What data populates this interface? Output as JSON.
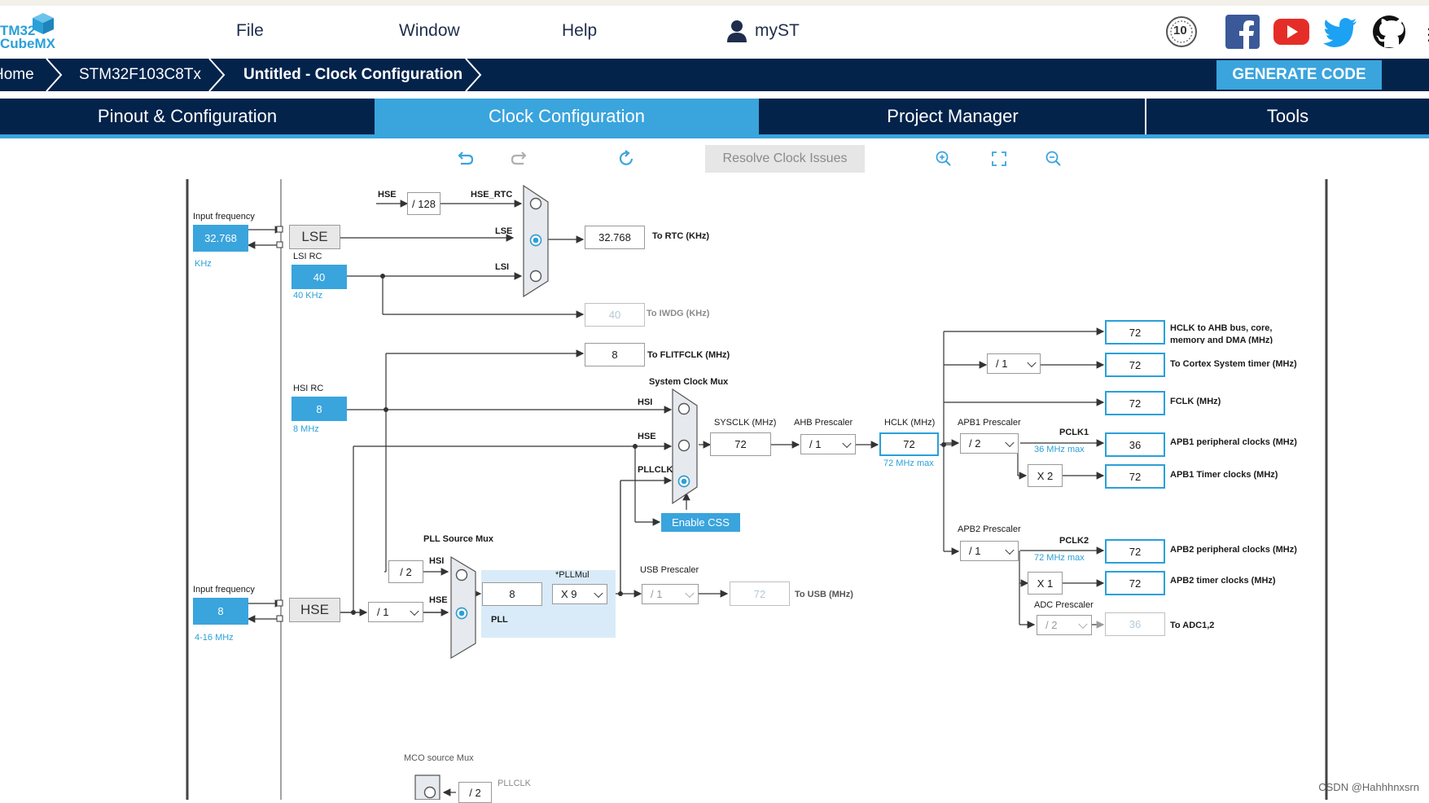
{
  "app": {
    "logo_line1": "TM32",
    "logo_line2": "CubeMX"
  },
  "menu": {
    "file": "File",
    "window": "Window",
    "help": "Help",
    "myst": "myST"
  },
  "badge": "10",
  "breadcrumb": {
    "home": "Home",
    "device": "STM32F103C8Tx",
    "page": "Untitled - Clock Configuration"
  },
  "generate_code": "GENERATE CODE",
  "tabs": {
    "pinout": "Pinout & Configuration",
    "clock": "Clock Configuration",
    "project": "Project Manager",
    "tools": "Tools"
  },
  "toolbar": {
    "resolve": "Resolve Clock Issues"
  },
  "diagram": {
    "lse_input_label": "Input frequency",
    "lse_input_value": "32.768",
    "lse_input_unit": "KHz",
    "lse_label": "LSE",
    "lsi_rc_label": "LSI RC",
    "lsi_value": "40",
    "lsi_unit": "40 KHz",
    "hse_rtc_src": "HSE",
    "hse_rtc_div": "/ 128",
    "hse_rtc_label": "HSE_RTC",
    "rtc_lse_label": "LSE",
    "rtc_lsi_label": "LSI",
    "rtc_value": "32.768",
    "rtc_out": "To RTC (KHz)",
    "iwdg_value": "40",
    "iwdg_out": "To IWDG (KHz)",
    "flit_value": "8",
    "flit_out": "To FLITFCLK (MHz)",
    "hsi_rc_label": "HSI RC",
    "hsi_value": "8",
    "hsi_unit": "8 MHz",
    "sys_mux_label": "System Clock Mux",
    "mux_hsi": "HSI",
    "mux_hse": "HSE",
    "mux_pllclk": "PLLCLK",
    "enable_css": "Enable CSS",
    "sysclk_label": "SYSCLK (MHz)",
    "sysclk_value": "72",
    "ahb_label": "AHB Prescaler",
    "ahb_value": "/ 1",
    "hclk_label": "HCLK (MHz)",
    "hclk_value": "72",
    "hclk_max": "72 MHz max",
    "apb1_label": "APB1 Prescaler",
    "apb1_value": "/ 2",
    "pclk1_label": "PCLK1",
    "pclk1_max": "36 MHz max",
    "apb1_x2": "X 2",
    "apb2_label": "APB2 Prescaler",
    "apb2_value": "/ 1",
    "pclk2_label": "PCLK2",
    "pclk2_max": "72 MHz max",
    "apb2_x1": "X 1",
    "adc_label": "ADC Prescaler",
    "adc_value": "/ 2",
    "cortex_div": "/ 1",
    "outputs": [
      {
        "value": "72",
        "label": "HCLK to AHB bus, core,",
        "label2": "memory and DMA (MHz)"
      },
      {
        "value": "72",
        "label": "To Cortex System timer (MHz)",
        "label2": ""
      },
      {
        "value": "72",
        "label": "FCLK (MHz)",
        "label2": ""
      },
      {
        "value": "36",
        "label": "APB1 peripheral clocks (MHz)",
        "label2": ""
      },
      {
        "value": "72",
        "label": "APB1 Timer clocks (MHz)",
        "label2": ""
      },
      {
        "value": "72",
        "label": "APB2 peripheral clocks (MHz)",
        "label2": ""
      },
      {
        "value": "72",
        "label": "APB2 timer clocks (MHz)",
        "label2": ""
      }
    ],
    "adc_out_value": "36",
    "adc_out": "To ADC1,2",
    "pll_src_label": "PLL Source Mux",
    "pll_div2": "/ 2",
    "pll_hsi": "HSI",
    "pll_hse": "HSE",
    "pll_in_value": "8",
    "pllmul_label": "*PLLMul",
    "pllmul_value": "X 9",
    "pll_label": "PLL",
    "usb_label": "USB Prescaler",
    "usb_div": "/ 1",
    "usb_value": "72",
    "usb_out": "To USB (MHz)",
    "hse_input_label": "Input frequency",
    "hse_input_value": "8",
    "hse_input_unit": "4-16 MHz",
    "hse_label": "HSE",
    "hse_div": "/ 1",
    "mco_label": "MCO source Mux",
    "mco_div": "/ 2",
    "mco_pllclk": "PLLCLK"
  },
  "watermark": "CSDN @Hahhhnxsrn",
  "colors": {
    "navy": "#03234b",
    "accent": "#3aa4dd"
  }
}
